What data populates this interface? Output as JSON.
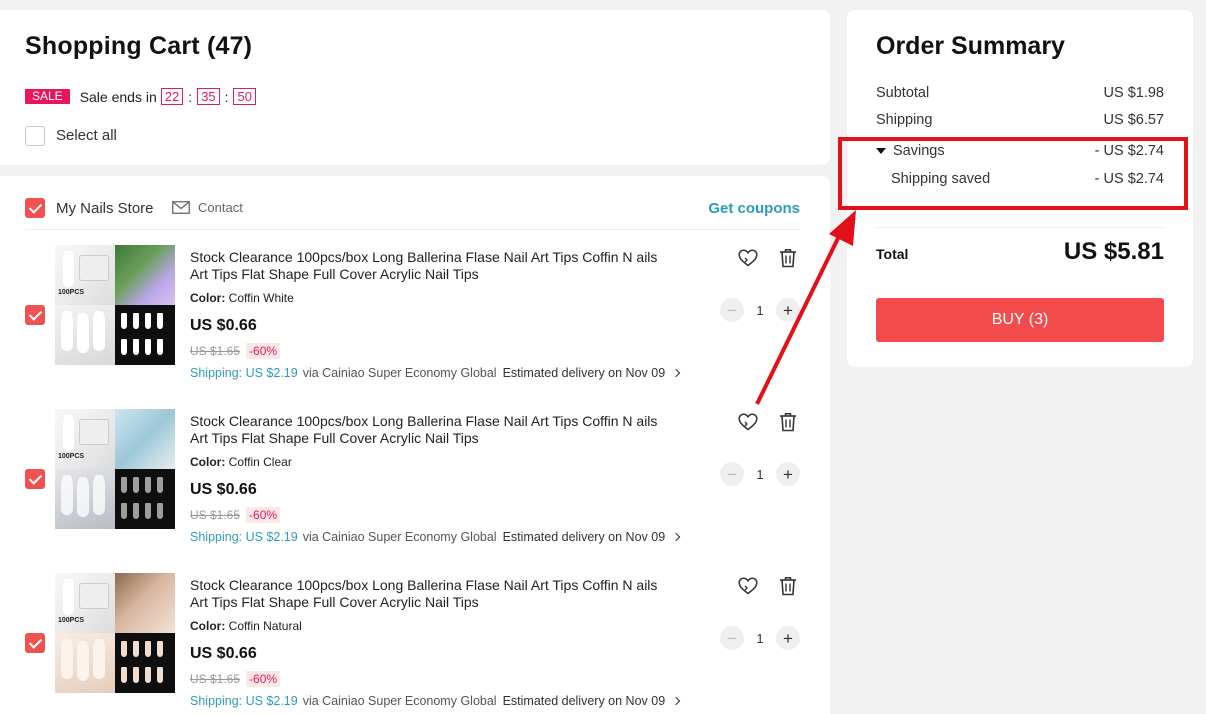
{
  "cart": {
    "title": "Shopping Cart (47)",
    "sale_badge": "SALE",
    "sale_text": "Sale ends in",
    "timer": [
      "22",
      "35",
      "50"
    ],
    "select_all": "Select all"
  },
  "store": {
    "name": "My Nails Store",
    "contact": "Contact",
    "coupons": "Get coupons"
  },
  "items": [
    {
      "title": "Stock Clearance 100pcs/box Long Ballerina Flase Nail Art Tips Coffin N ails Art Tips Flat Shape Full Cover Acrylic Nail Tips",
      "color_label": "Color:",
      "color_value": "Coffin White",
      "price": "US $0.66",
      "old_price": "US $1.65",
      "discount": "-60%",
      "shipping_cost": "Shipping: US $2.19",
      "shipping_via": "via Cainiao Super Economy Global",
      "delivery": "Estimated delivery on Nov 09",
      "qty": "1",
      "checked": true
    },
    {
      "title": "Stock Clearance 100pcs/box Long Ballerina Flase Nail Art Tips Coffin N ails Art Tips Flat Shape Full Cover Acrylic Nail Tips",
      "color_label": "Color:",
      "color_value": "Coffin Clear",
      "price": "US $0.66",
      "old_price": "US $1.65",
      "discount": "-60%",
      "shipping_cost": "Shipping: US $2.19",
      "shipping_via": "via Cainiao Super Economy Global",
      "delivery": "Estimated delivery on Nov 09",
      "qty": "1",
      "checked": true
    },
    {
      "title": "Stock Clearance 100pcs/box Long Ballerina Flase Nail Art Tips Coffin N ails Art Tips Flat Shape Full Cover Acrylic Nail Tips",
      "color_label": "Color:",
      "color_value": "Coffin Natural",
      "price": "US $0.66",
      "old_price": "US $1.65",
      "discount": "-60%",
      "shipping_cost": "Shipping: US $2.19",
      "shipping_via": "via Cainiao Super Economy Global",
      "delivery": "Estimated delivery on Nov 09",
      "qty": "1",
      "checked": true
    }
  ],
  "thumb_caption": "100PCS",
  "summary": {
    "title": "Order Summary",
    "subtotal_label": "Subtotal",
    "subtotal_value": "US $1.98",
    "shipping_label": "Shipping",
    "shipping_value": "US $6.57",
    "savings_label": "Savings",
    "savings_value": "- US $2.74",
    "shipping_saved_label": "Shipping saved",
    "shipping_saved_value": "- US $2.74",
    "total_label": "Total",
    "total_value": "US $5.81",
    "buy_label": "BUY (3)"
  },
  "colors": {
    "accent": "#f44c4c",
    "sale": "#e8175d",
    "link": "#2e9cbf",
    "annotation": "#e3101a"
  }
}
